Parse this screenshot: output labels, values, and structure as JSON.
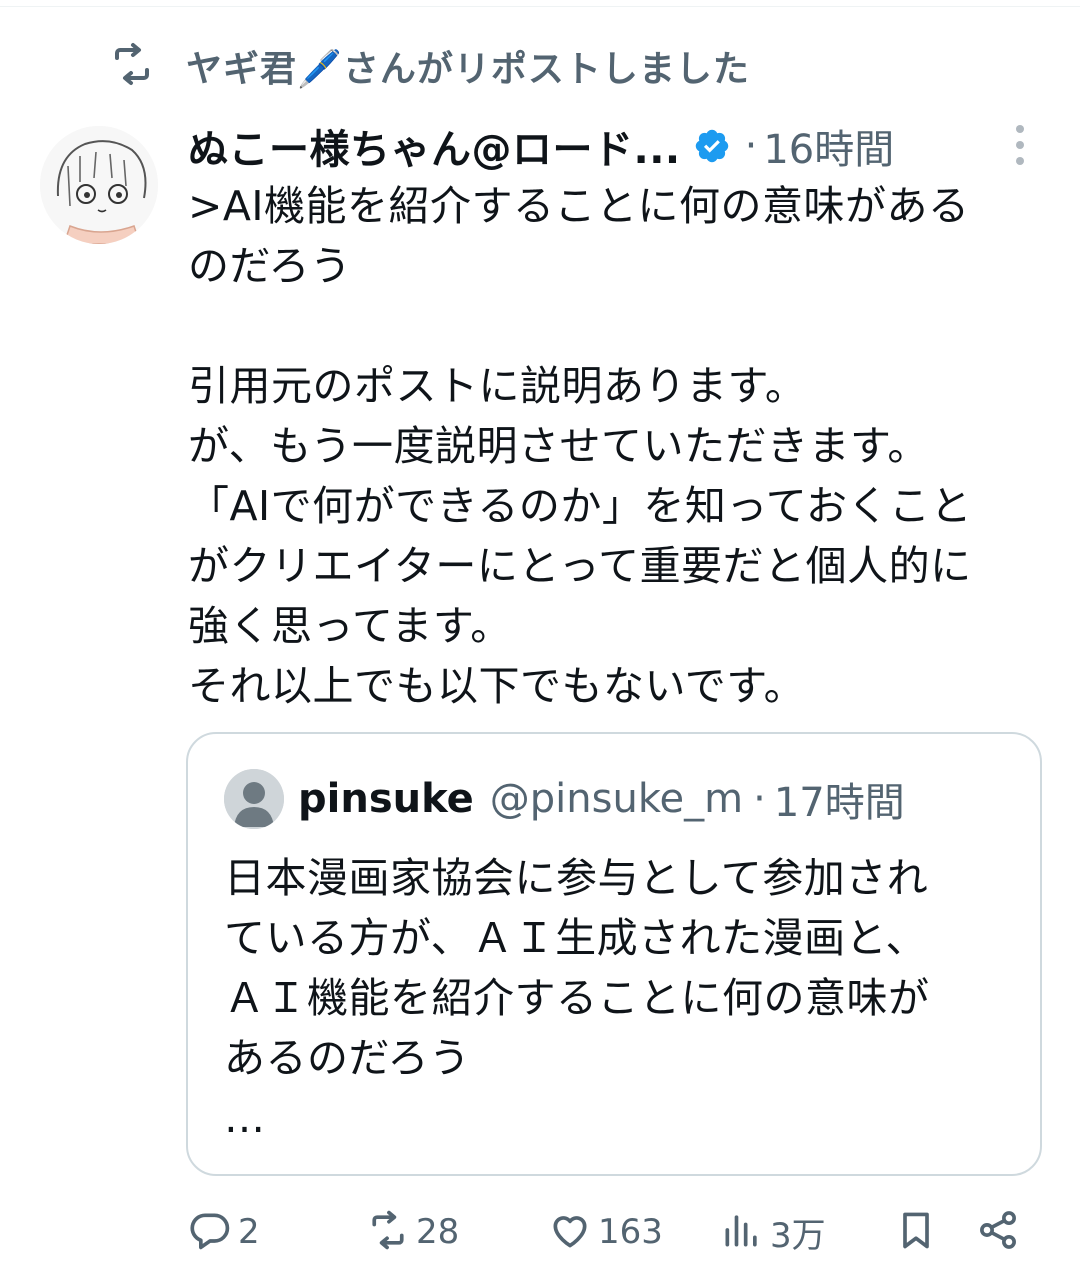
{
  "repost": {
    "label": "ヤギ君🖊️さんがリポストしました",
    "icon": "repost-icon"
  },
  "tweet": {
    "display_name": "ぬこー様ちゃん@ロード...",
    "verified_color": "#1d9bf0",
    "separator": "·",
    "time": "16時間",
    "body": ">AI機能を紹介することに何の意味がある\nのだろう\n\n引用元のポストに説明あります。\nが、もう一度説明させていただきます。\n「AIで何ができるのか」を知っておくこと\nがクリエイターにとって重要だと個人的に\n強く思ってます。\nそれ以上でも以下でもないです。"
  },
  "quote": {
    "name": "pinsuke",
    "handle": "@pinsuke_m",
    "separator": "·",
    "time": "17時間",
    "body": "日本漫画家協会に参与として参加され\nている方が、ＡＩ生成された漫画と、\nＡＩ機能を紹介することに何の意味が\nあるのだろう\n…"
  },
  "actions": {
    "reply_count": "2",
    "repost_count": "28",
    "like_count": "163",
    "views_count": "3万"
  },
  "colors": {
    "text": "#0f1419",
    "secondary": "#536471",
    "border": "#cfd9de",
    "verified": "#1d9bf0"
  }
}
